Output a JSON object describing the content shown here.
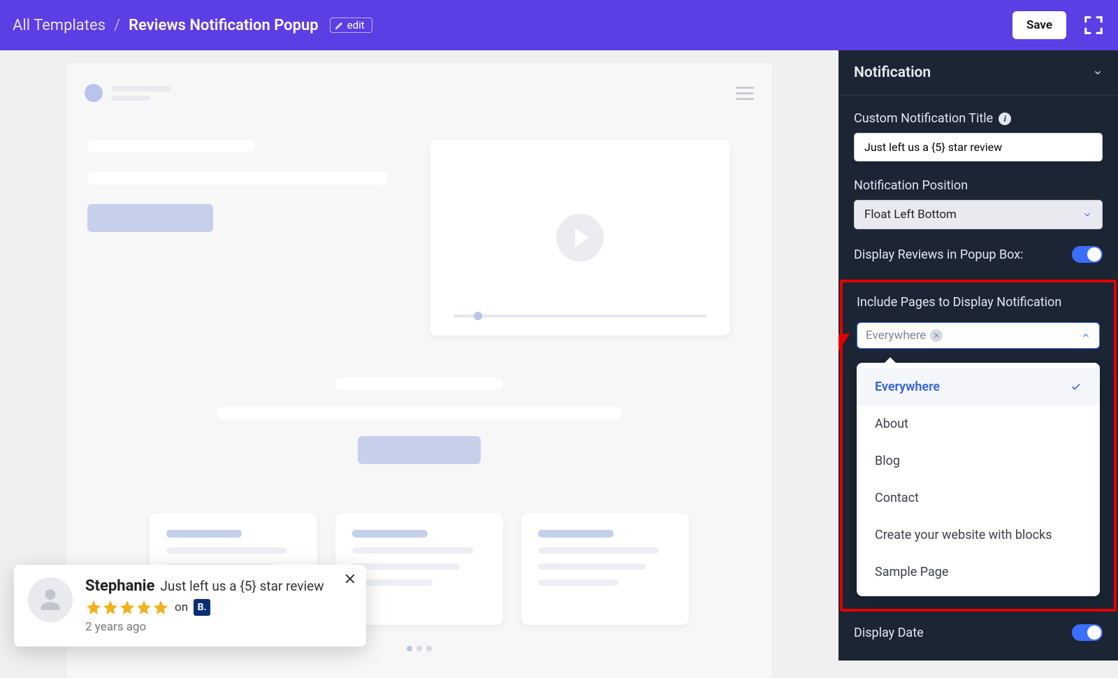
{
  "header": {
    "breadcrumb_root": "All Templates",
    "title": "Reviews Notification Popup",
    "edit_label": "edit",
    "save_label": "Save"
  },
  "review_popup": {
    "name": "Stephanie",
    "message": "Just left us a {5} star review",
    "on_label": "on",
    "source_badge": "B.",
    "timestamp": "2 years ago",
    "stars": 5
  },
  "sidebar": {
    "panel_title": "Notification",
    "custom_title_label": "Custom Notification Title",
    "custom_title_value": "Just left us a {5} star review",
    "position_label": "Notification Position",
    "position_value": "Float Left Bottom",
    "display_popup_label": "Display Reviews in Popup Box:",
    "include_pages_label": "Include Pages to Display Notification",
    "include_pages_chip": "Everywhere",
    "dropdown_options": [
      "Everywhere",
      "About",
      "Blog",
      "Contact",
      "Create your website with blocks",
      "Sample Page"
    ],
    "dropdown_selected_index": 0,
    "display_date_label": "Display Date"
  }
}
